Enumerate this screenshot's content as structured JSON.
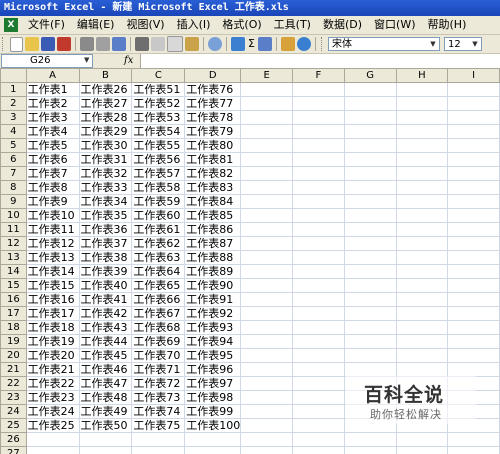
{
  "window": {
    "title": "Microsoft Excel - 新建 Microsoft Excel 工作表.xls"
  },
  "menubar": {
    "app_icon": "excel-icon",
    "items": [
      "文件(F)",
      "编辑(E)",
      "视图(V)",
      "插入(I)",
      "格式(O)",
      "工具(T)",
      "数据(D)",
      "窗口(W)",
      "帮助(H)"
    ]
  },
  "toolbar": {
    "font_name": "宋体",
    "font_size": "12",
    "sigma": "Σ"
  },
  "formula_bar": {
    "cell_ref": "G26",
    "fx": "fx",
    "value": ""
  },
  "sheet": {
    "columns": [
      "A",
      "B",
      "C",
      "D",
      "E",
      "F",
      "G",
      "H",
      "I"
    ],
    "rows": [
      {
        "num": "1",
        "a": "工作表1",
        "b": "工作表26",
        "c": "工作表51",
        "d": "工作表76"
      },
      {
        "num": "2",
        "a": "工作表2",
        "b": "工作表27",
        "c": "工作表52",
        "d": "工作表77"
      },
      {
        "num": "3",
        "a": "工作表3",
        "b": "工作表28",
        "c": "工作表53",
        "d": "工作表78"
      },
      {
        "num": "4",
        "a": "工作表4",
        "b": "工作表29",
        "c": "工作表54",
        "d": "工作表79"
      },
      {
        "num": "5",
        "a": "工作表5",
        "b": "工作表30",
        "c": "工作表55",
        "d": "工作表80"
      },
      {
        "num": "6",
        "a": "工作表6",
        "b": "工作表31",
        "c": "工作表56",
        "d": "工作表81"
      },
      {
        "num": "7",
        "a": "工作表7",
        "b": "工作表32",
        "c": "工作表57",
        "d": "工作表82"
      },
      {
        "num": "8",
        "a": "工作表8",
        "b": "工作表33",
        "c": "工作表58",
        "d": "工作表83"
      },
      {
        "num": "9",
        "a": "工作表9",
        "b": "工作表34",
        "c": "工作表59",
        "d": "工作表84"
      },
      {
        "num": "10",
        "a": "工作表10",
        "b": "工作表35",
        "c": "工作表60",
        "d": "工作表85"
      },
      {
        "num": "11",
        "a": "工作表11",
        "b": "工作表36",
        "c": "工作表61",
        "d": "工作表86"
      },
      {
        "num": "12",
        "a": "工作表12",
        "b": "工作表37",
        "c": "工作表62",
        "d": "工作表87"
      },
      {
        "num": "13",
        "a": "工作表13",
        "b": "工作表38",
        "c": "工作表63",
        "d": "工作表88"
      },
      {
        "num": "14",
        "a": "工作表14",
        "b": "工作表39",
        "c": "工作表64",
        "d": "工作表89"
      },
      {
        "num": "15",
        "a": "工作表15",
        "b": "工作表40",
        "c": "工作表65",
        "d": "工作表90"
      },
      {
        "num": "16",
        "a": "工作表16",
        "b": "工作表41",
        "c": "工作表66",
        "d": "工作表91"
      },
      {
        "num": "17",
        "a": "工作表17",
        "b": "工作表42",
        "c": "工作表67",
        "d": "工作表92"
      },
      {
        "num": "18",
        "a": "工作表18",
        "b": "工作表43",
        "c": "工作表68",
        "d": "工作表93"
      },
      {
        "num": "19",
        "a": "工作表19",
        "b": "工作表44",
        "c": "工作表69",
        "d": "工作表94"
      },
      {
        "num": "20",
        "a": "工作表20",
        "b": "工作表45",
        "c": "工作表70",
        "d": "工作表95"
      },
      {
        "num": "21",
        "a": "工作表21",
        "b": "工作表46",
        "c": "工作表71",
        "d": "工作表96"
      },
      {
        "num": "22",
        "a": "工作表22",
        "b": "工作表47",
        "c": "工作表72",
        "d": "工作表97"
      },
      {
        "num": "23",
        "a": "工作表23",
        "b": "工作表48",
        "c": "工作表73",
        "d": "工作表98"
      },
      {
        "num": "24",
        "a": "工作表24",
        "b": "工作表49",
        "c": "工作表74",
        "d": "工作表99"
      },
      {
        "num": "25",
        "a": "工作表25",
        "b": "工作表50",
        "c": "工作表75",
        "d": "工作表100"
      },
      {
        "num": "26",
        "a": "",
        "b": "",
        "c": "",
        "d": ""
      },
      {
        "num": "27",
        "a": "",
        "b": "",
        "c": "",
        "d": ""
      }
    ]
  },
  "watermark": {
    "title": "百科全说",
    "subtitle": "助你轻松解决"
  }
}
